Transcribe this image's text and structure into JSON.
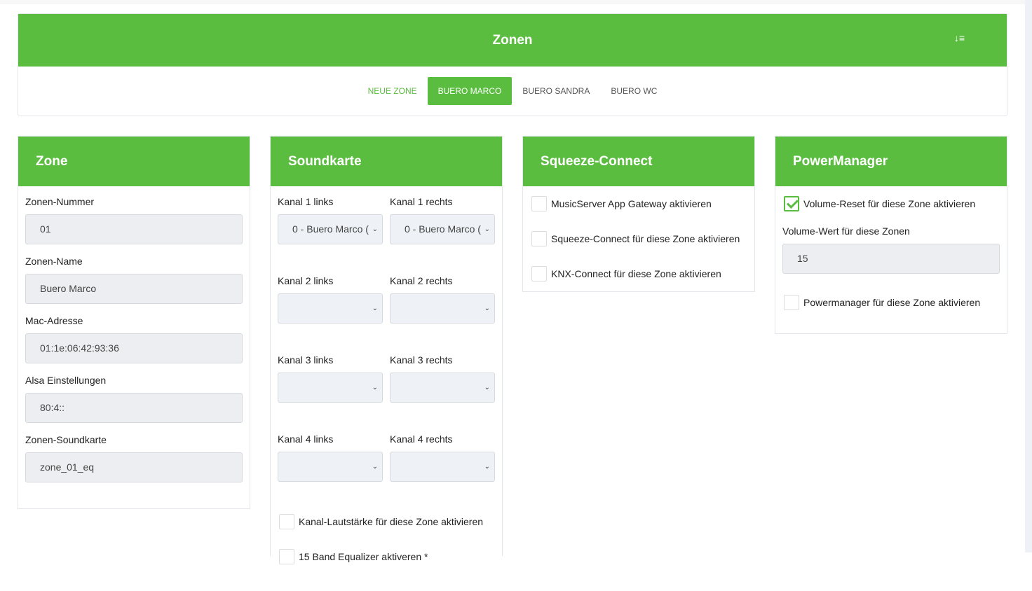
{
  "header": {
    "title": "Zonen",
    "sort_icon": "sort-descending-icon"
  },
  "tabs": [
    {
      "label": "NEUE ZONE"
    },
    {
      "label": "BUERO MARCO"
    },
    {
      "label": "BUERO SANDRA"
    },
    {
      "label": "BUERO WC"
    }
  ],
  "zone": {
    "title": "Zone",
    "fields": [
      {
        "label": "Zonen-Nummer",
        "value": "01"
      },
      {
        "label": "Zonen-Name",
        "value": "Buero Marco"
      },
      {
        "label": "Mac-Adresse",
        "value": "01:1e:06:42:93:36"
      },
      {
        "label": "Alsa Einstellungen",
        "value": "80:4::"
      },
      {
        "label": "Zonen-Soundkarte",
        "value": "zone_01_eq"
      }
    ]
  },
  "sound": {
    "title": "Soundkarte",
    "channels": [
      {
        "label": "Kanal 1 links",
        "value": "0 - Buero Marco ("
      },
      {
        "label": "Kanal 1 rechts",
        "value": "0 - Buero Marco ("
      },
      {
        "label": "Kanal 2 links",
        "value": ""
      },
      {
        "label": "Kanal 2 rechts",
        "value": ""
      },
      {
        "label": "Kanal 3 links",
        "value": ""
      },
      {
        "label": "Kanal 3 rechts",
        "value": ""
      },
      {
        "label": "Kanal 4 links",
        "value": ""
      },
      {
        "label": "Kanal 4 rechts",
        "value": ""
      }
    ],
    "checks": [
      {
        "label": "Kanal-Lautstärke für diese Zone aktivieren",
        "checked": false
      },
      {
        "label": "15 Band Equalizer aktiveren *",
        "checked": false
      }
    ]
  },
  "squeeze": {
    "title": "Squeeze-Connect",
    "checks": [
      {
        "label": "MusicServer App Gateway aktivieren",
        "checked": false
      },
      {
        "label": "Squeeze-Connect für diese Zone aktivieren",
        "checked": false
      },
      {
        "label": "KNX-Connect für diese Zone aktivieren",
        "checked": false
      }
    ]
  },
  "power": {
    "title": "PowerManager",
    "reset_label": "Volume-Reset für diese Zone aktivieren",
    "reset_checked": true,
    "volume_label": "Volume-Wert für diese Zonen",
    "volume_value": "15",
    "pm_label": "Powermanager für diese Zone aktivieren",
    "pm_checked": false
  },
  "colors": {
    "accent": "#5bbd40"
  }
}
